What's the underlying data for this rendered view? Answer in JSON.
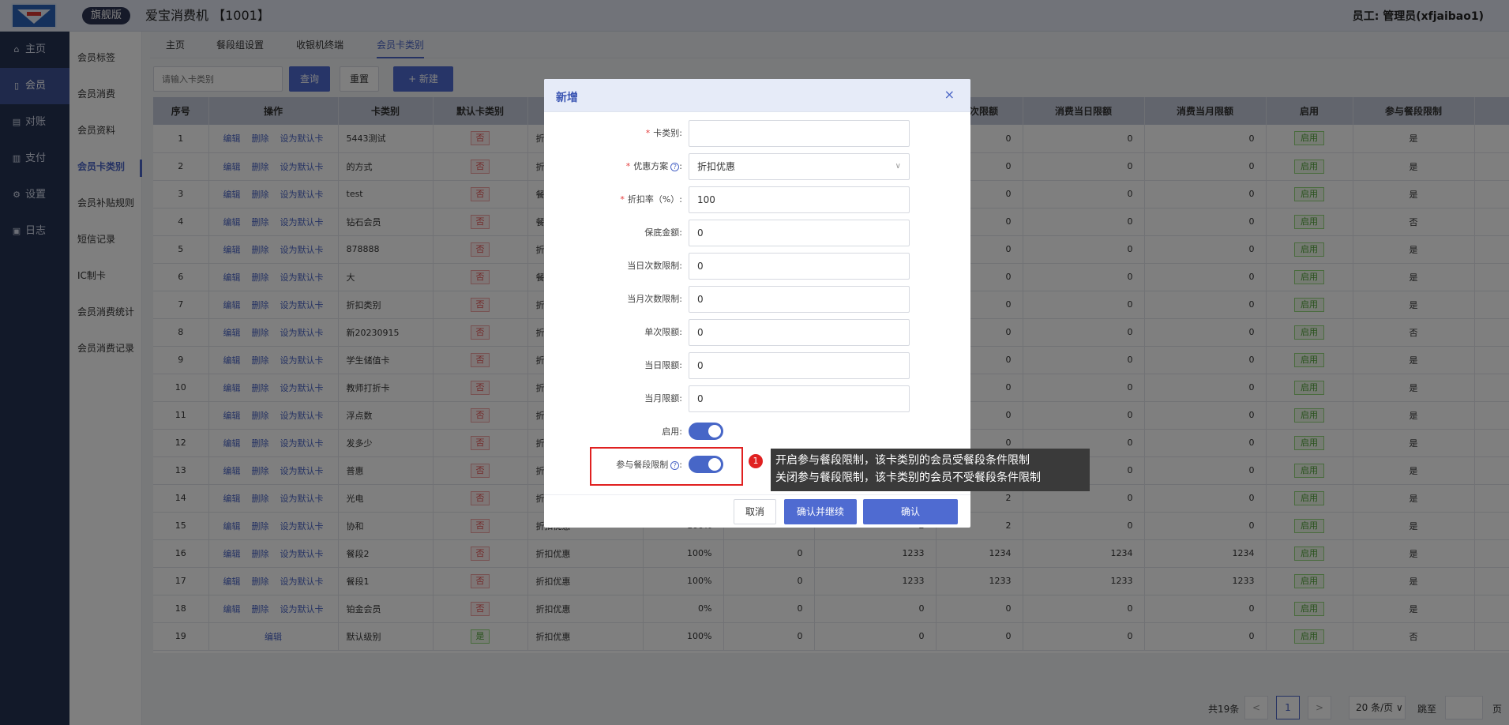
{
  "header": {
    "edition": "旗舰版",
    "title": "爱宝消费机 【1001】",
    "user": "员工: 管理员(xfjaibao1)"
  },
  "sidebar": {
    "items": [
      {
        "icon": "home-icon",
        "glyph": "⌂",
        "label": "主页"
      },
      {
        "icon": "member-icon",
        "glyph": "▯",
        "label": "会员"
      },
      {
        "icon": "reconcile-icon",
        "glyph": "▤",
        "label": "对账"
      },
      {
        "icon": "payment-icon",
        "glyph": "▥",
        "label": "支付"
      },
      {
        "icon": "settings-icon",
        "glyph": "⚙",
        "label": "设置"
      },
      {
        "icon": "log-icon",
        "glyph": "▣",
        "label": "日志"
      }
    ]
  },
  "subnav": {
    "items": [
      "会员标签",
      "会员消费",
      "会员资料",
      "会员卡类别",
      "会员补贴规则",
      "短信记录",
      "IC制卡",
      "会员消费统计",
      "会员消费记录"
    ]
  },
  "tabs": [
    "主页",
    "餐段组设置",
    "收银机终端",
    "会员卡类别"
  ],
  "toolbar": {
    "search_placeholder": "请输入卡类别",
    "query": "查询",
    "reset": "重置",
    "add": "+ 新建"
  },
  "table": {
    "headers": [
      "序号",
      "操作",
      "卡类别",
      "默认卡类别",
      "优",
      "",
      "",
      "",
      "单次限额",
      "消费当日限额",
      "消费当月限额",
      "启用",
      "参与餐段限制"
    ],
    "ops": {
      "edit": "编辑",
      "delete": "删除",
      "set_default": "设为默认卡"
    },
    "badge_no": "否",
    "badge_yes": "是",
    "enabled": "启用",
    "rows": [
      {
        "no": "1",
        "name": "5443测试",
        "plan": "折",
        "rate": "",
        "c6": "",
        "c7": "",
        "single": "0",
        "day": "0",
        "month": "0",
        "meal": "是"
      },
      {
        "no": "2",
        "name": "的方式",
        "plan": "折",
        "rate": "",
        "c6": "",
        "c7": "",
        "single": "0",
        "day": "0",
        "month": "0",
        "meal": "是"
      },
      {
        "no": "3",
        "name": "test",
        "plan": "餐",
        "rate": "",
        "c6": "",
        "c7": "",
        "single": "0",
        "day": "0",
        "month": "0",
        "meal": "是"
      },
      {
        "no": "4",
        "name": "钻石会员",
        "plan": "餐",
        "rate": "",
        "c6": "",
        "c7": "",
        "single": "0",
        "day": "0",
        "month": "0",
        "meal": "否"
      },
      {
        "no": "5",
        "name": "878888",
        "plan": "折",
        "rate": "",
        "c6": "",
        "c7": "",
        "single": "0",
        "day": "0",
        "month": "0",
        "meal": "是"
      },
      {
        "no": "6",
        "name": "大",
        "plan": "餐",
        "rate": "",
        "c6": "",
        "c7": "",
        "single": "0",
        "day": "0",
        "month": "0",
        "meal": "是"
      },
      {
        "no": "7",
        "name": "折扣类别",
        "plan": "折",
        "rate": "",
        "c6": "",
        "c7": "",
        "single": "0",
        "day": "0",
        "month": "0",
        "meal": "是"
      },
      {
        "no": "8",
        "name": "新20230915",
        "plan": "折",
        "rate": "",
        "c6": "",
        "c7": "",
        "single": "0",
        "day": "0",
        "month": "0",
        "meal": "否"
      },
      {
        "no": "9",
        "name": "学生储值卡",
        "plan": "折",
        "rate": "",
        "c6": "",
        "c7": "",
        "single": "0",
        "day": "0",
        "month": "0",
        "meal": "是"
      },
      {
        "no": "10",
        "name": "教师打折卡",
        "plan": "折",
        "rate": "",
        "c6": "",
        "c7": "",
        "single": "0",
        "day": "0",
        "month": "0",
        "meal": "是"
      },
      {
        "no": "11",
        "name": "浮点数",
        "plan": "折",
        "rate": "",
        "c6": "",
        "c7": "",
        "single": "0",
        "day": "0",
        "month": "0",
        "meal": "是"
      },
      {
        "no": "12",
        "name": "发多少",
        "plan": "折",
        "rate": "",
        "c6": "",
        "c7": "",
        "single": "0",
        "day": "0",
        "month": "0",
        "meal": "是"
      },
      {
        "no": "13",
        "name": "普惠",
        "plan": "折",
        "rate": "",
        "c6": "",
        "c7": "",
        "single": "",
        "day": "0",
        "month": "0",
        "meal": "是"
      },
      {
        "no": "14",
        "name": "光电",
        "plan": "折",
        "rate": "",
        "c6": "",
        "c7": "",
        "single": "2",
        "day": "0",
        "month": "0",
        "meal": "是"
      },
      {
        "no": "15",
        "name": "协和",
        "plan": "折扣优惠",
        "rate": "100%",
        "c6": "",
        "c7": "2",
        "single": "2",
        "day": "0",
        "month": "0",
        "meal": "是"
      },
      {
        "no": "16",
        "name": "餐段2",
        "plan": "折扣优惠",
        "rate": "100%",
        "c6": "0",
        "c7": "1233",
        "single": "1234",
        "day": "1234",
        "month": "1234",
        "meal": "是"
      },
      {
        "no": "17",
        "name": "餐段1",
        "plan": "折扣优惠",
        "rate": "100%",
        "c6": "0",
        "c7": "1233",
        "single": "1233",
        "day": "1233",
        "month": "1233",
        "meal": "是"
      },
      {
        "no": "18",
        "name": "铂金会员",
        "plan": "折扣优惠",
        "rate": "0%",
        "c6": "0",
        "c7": "0",
        "single": "0",
        "day": "0",
        "month": "0",
        "meal": "是"
      },
      {
        "no": "19",
        "name": "默认级别",
        "plan": "折扣优惠",
        "rate": "100%",
        "c6": "0",
        "c7": "0",
        "single": "0",
        "day": "0",
        "month": "0",
        "meal": "否",
        "default": true
      }
    ]
  },
  "pager": {
    "total": "共19条",
    "prev": "<",
    "current": "1",
    "next": ">",
    "size": "20 条/页 ∨",
    "jump": "跳至",
    "unit": "页"
  },
  "modal": {
    "title": "新增",
    "close": "×",
    "fields": [
      {
        "label": "卡类别:",
        "required": true,
        "help": false,
        "type": "input",
        "value": ""
      },
      {
        "label": "优惠方案",
        "required": true,
        "help": true,
        "type": "select",
        "value": "折扣优惠"
      },
      {
        "label": "折扣率（%）:",
        "required": true,
        "help": false,
        "type": "input",
        "value": "100"
      },
      {
        "label": "保底金额:",
        "required": false,
        "help": false,
        "type": "input",
        "value": "0"
      },
      {
        "label": "当日次数限制:",
        "required": false,
        "help": false,
        "type": "input",
        "value": "0"
      },
      {
        "label": "当月次数限制:",
        "required": false,
        "help": false,
        "type": "input",
        "value": "0"
      },
      {
        "label": "单次限额:",
        "required": false,
        "help": false,
        "type": "input",
        "value": "0"
      },
      {
        "label": "当日限额:",
        "required": false,
        "help": false,
        "type": "input",
        "value": "0"
      },
      {
        "label": "当月限额:",
        "required": false,
        "help": false,
        "type": "input",
        "value": "0"
      },
      {
        "label": "启用:",
        "required": false,
        "help": false,
        "type": "switch",
        "value": "on"
      },
      {
        "label": "参与餐段限制",
        "required": false,
        "help": true,
        "type": "switch",
        "value": "on"
      }
    ],
    "cancel": "取消",
    "confirm_continue": "确认并继续",
    "confirm": "确认"
  },
  "annotation": {
    "marker": "1",
    "line1": "开启参与餐段限制，该卡类别的会员受餐段条件限制",
    "line2": "关闭参与餐段限制，该卡类别的会员不受餐段条件限制"
  }
}
